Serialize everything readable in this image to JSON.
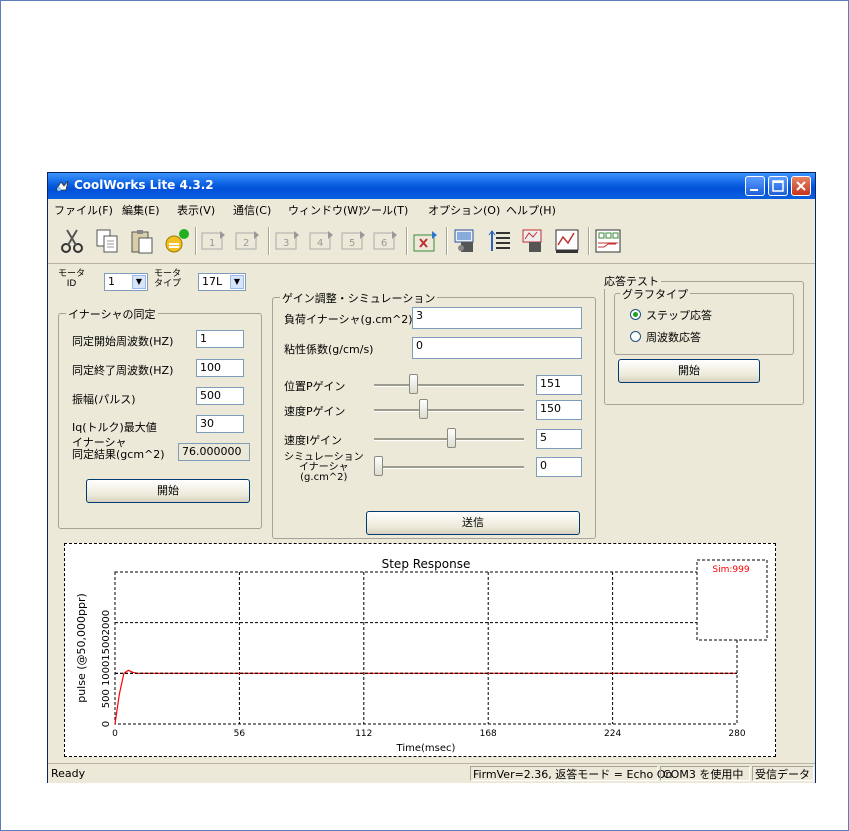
{
  "window": {
    "title": "CoolWorks Lite 4.3.2"
  },
  "menu": [
    "ファイル(F)",
    "編集(E)",
    "表示(V)",
    "通信(C)",
    "ウィンドウ(W)",
    "ツール(T)",
    "オプション(O)",
    "ヘルプ(H)"
  ],
  "toolbar": {
    "icons": [
      "cut-icon",
      "copy-icon",
      "paste-icon",
      "connect-icon",
      "tool1-icon",
      "tool2-icon",
      "tool3-icon",
      "tool4-icon",
      "tool5-icon",
      "tool6-icon",
      "tool-x-icon",
      "motor-icon",
      "list-icon",
      "motor-graph-icon",
      "chart-icon",
      "panel-icon"
    ],
    "labels": [
      "1",
      "2",
      "3",
      "4",
      "5",
      "6"
    ]
  },
  "left": {
    "motor_id_label": "モータ\nID",
    "motor_id_value": "1",
    "motor_type_label": "モータ\nタイプ",
    "motor_type_value": "17L",
    "group_title": "イナーシャの同定",
    "start_freq_label": "同定開始周波数(HZ)",
    "start_freq_value": "1",
    "end_freq_label": "同定終了周波数(HZ)",
    "end_freq_value": "100",
    "amplitude_label": "振幅(パルス)",
    "amplitude_value": "500",
    "iq_label": "Iq(トルク)最大値",
    "iq_value": "30",
    "result_label": "イナーシャ\n同定結果(gcm^2)",
    "result_value": "76.000000",
    "start_button": "開始"
  },
  "middle": {
    "group_title": "ゲイン調整・シミュレーション",
    "load_inertia_label": "負荷イナーシャ(g.cm^2)",
    "load_inertia_value": "3",
    "viscosity_label": "粘性係数(g/cm/s)",
    "viscosity_value": "0",
    "sliders": [
      {
        "label": "位置Pゲイン",
        "value": "151",
        "level": 0.25
      },
      {
        "label": "速度Pゲイン",
        "value": "150",
        "level": 0.32
      },
      {
        "label": "速度Iゲイン",
        "value": "5",
        "level": 0.52
      },
      {
        "label": "シミュレーション\nイナーシャ\n(g.cm^2)",
        "value": "0",
        "level": 0.0
      }
    ],
    "send_button": "送信"
  },
  "right": {
    "group_title": "応答テスト",
    "graph_type_title": "グラフタイプ",
    "radio_step": "ステップ応答",
    "radio_freq": "周波数応答",
    "selected": "step",
    "start_button": "開始"
  },
  "chart_data": {
    "type": "line",
    "title": "Step Response",
    "xlabel": "Time(msec)",
    "ylabel": "pulse (@50,000ppr)",
    "xlim": [
      0,
      280
    ],
    "ylim": [
      0,
      3000
    ],
    "x_ticks": [
      "0",
      "56",
      "112",
      "168",
      "224",
      "280"
    ],
    "y_ticks": [
      "0",
      "500",
      "1000",
      "1500",
      "2000",
      "2500",
      "3000"
    ],
    "y_tick_labels": [
      "0",
      "500",
      "1000",
      "1500",
      "2000"
    ],
    "legend": "Sim:999",
    "grid": true,
    "series": [
      {
        "x": [
          0,
          2,
          4,
          6,
          8,
          10,
          20,
          280
        ],
        "y": [
          0,
          600,
          1000,
          1060,
          1020,
          1000,
          1000,
          1000
        ],
        "color": "#ff0000"
      },
      {
        "x": [
          0,
          280
        ],
        "y": [
          1000,
          1000
        ],
        "color": "#000000",
        "dashed": true
      }
    ]
  },
  "status": {
    "left": "Ready",
    "firm": "FirmVer=2.36, 返答モード = Echo On",
    "com": "COM3 を使用中",
    "recv": "受信データ"
  }
}
